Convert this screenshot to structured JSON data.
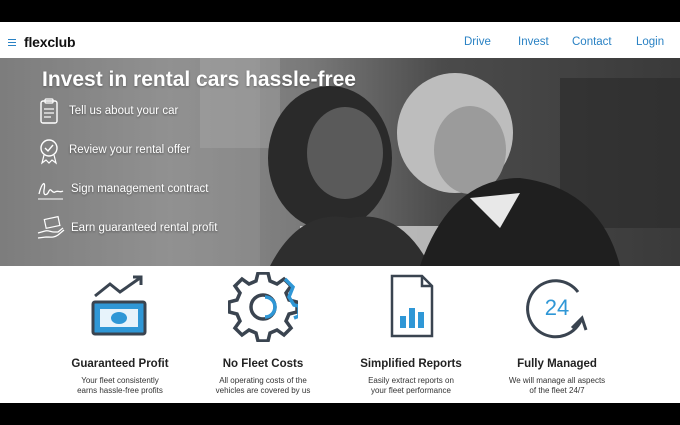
{
  "nav": {
    "logo": "flexclub",
    "links": [
      "Drive",
      "Invest",
      "Contact",
      "Login"
    ]
  },
  "hero": {
    "title": "Invest in rental cars hassle-free",
    "steps": [
      {
        "label": "Tell us about your car",
        "icon": "clipboard-icon"
      },
      {
        "label": "Review your rental offer",
        "icon": "badge-check-icon"
      },
      {
        "label": "Sign management contract",
        "icon": "signature-icon"
      },
      {
        "label": "Earn guaranteed rental profit",
        "icon": "hand-money-icon"
      }
    ]
  },
  "features": [
    {
      "title": "Guaranteed Profit",
      "desc1": "Your fleet consistently",
      "desc2": "earns hassle-free profits",
      "icon": "banknote-trend-icon"
    },
    {
      "title": "No Fleet Costs",
      "desc1": "All operating costs of the",
      "desc2": "vehicles are covered by us",
      "icon": "gear-icon"
    },
    {
      "title": "Simplified Reports",
      "desc1": "Easily extract reports on",
      "desc2": "your fleet performance",
      "icon": "report-icon"
    },
    {
      "title": "Fully Managed",
      "desc1": "We will manage all aspects",
      "desc2": "of the fleet 24/7",
      "icon": "clock-24-icon"
    }
  ],
  "colors": {
    "accent": "#2a82c4",
    "icon_dark": "#3a4450",
    "icon_blue": "#2f97d6"
  }
}
